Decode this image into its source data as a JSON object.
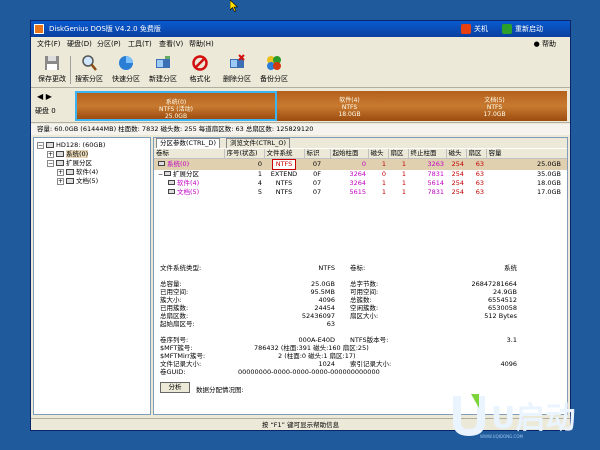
{
  "titlebar": {
    "title": "DiskGenius DOS版 V4.2.0 免费版",
    "shutdown_label": "关机",
    "restart_label": "重新启动"
  },
  "menu": [
    "文件(F)",
    "硬盘(D)",
    "分区(P)",
    "工具(T)",
    "查看(V)",
    "帮助(H)"
  ],
  "help_label": "帮助",
  "toolbar": [
    {
      "label": "保存更改",
      "icon": "save-icon"
    },
    {
      "label": "搜索分区",
      "icon": "magnifier-icon"
    },
    {
      "label": "快速分区",
      "icon": "quick-partition-icon"
    },
    {
      "label": "新建分区",
      "icon": "new-partition-icon"
    },
    {
      "label": "格式化",
      "icon": "format-icon"
    },
    {
      "label": "删除分区",
      "icon": "delete-partition-icon"
    },
    {
      "label": "备份分区",
      "icon": "backup-partition-icon"
    }
  ],
  "disk": {
    "nav_arrows": "◀ ▶",
    "label": "硬盘 0",
    "partitions": [
      {
        "name": "系统(0)",
        "fs": "NTFS (活动)",
        "size": "25.0GB"
      },
      {
        "name": "软件(4)",
        "fs": "NTFS",
        "size": "18.0GB"
      },
      {
        "name": "文档(5)",
        "fs": "NTFS",
        "size": "17.0GB"
      }
    ],
    "info": "容量: 60.0GB (61444MB)  柱面数: 7832  磁头数: 255  每道扇区数: 63  总扇区数: 125829120"
  },
  "tree": [
    {
      "label": "HD128: (60GB)",
      "expander": "−",
      "sel": false
    },
    {
      "label": "系统(0)",
      "expander": "+",
      "sel": true
    },
    {
      "label": "扩展分区",
      "expander": "−",
      "sel": false
    },
    {
      "label": "软件(4)",
      "expander": "+",
      "sel": false
    },
    {
      "label": "文档(5)",
      "expander": "+",
      "sel": false
    }
  ],
  "tabs": [
    "分区参数(CTRL_D)",
    "浏览文件(CTRL_O)"
  ],
  "table": {
    "headers": [
      "卷标",
      "序号(状态)",
      "文件系统",
      "标识",
      "起始柱面",
      "磁头",
      "扇区",
      "终止柱面",
      "磁头",
      "扇区",
      "容量"
    ],
    "rows": [
      [
        "系统(0)",
        "0",
        "NTFS",
        "07",
        "0",
        "1",
        "1",
        "3263",
        "254",
        "63",
        "25.0GB"
      ],
      [
        "扩展分区",
        "1",
        "EXTEND",
        "0F",
        "3264",
        "0",
        "1",
        "7831",
        "254",
        "63",
        "35.0GB"
      ],
      [
        "软件(4)",
        "4",
        "NTFS",
        "07",
        "3264",
        "1",
        "1",
        "5614",
        "254",
        "63",
        "18.0GB"
      ],
      [
        "文档(5)",
        "5",
        "NTFS",
        "07",
        "5615",
        "1",
        "1",
        "7831",
        "254",
        "63",
        "17.0GB"
      ]
    ]
  },
  "details": [
    {
      "k1": "文件系统类型:",
      "v1": "NTFS",
      "k2": "卷标:",
      "v2": "系统"
    },
    {
      "k1": "",
      "v1": "",
      "k2": "",
      "v2": ""
    },
    {
      "k1": "总容量:",
      "v1": "25.0GB",
      "k2": "总字节数:",
      "v2": "26847281664"
    },
    {
      "k1": "已用空间:",
      "v1": "95.5MB",
      "k2": "可用空间:",
      "v2": "24.9GB"
    },
    {
      "k1": "簇大小:",
      "v1": "4096",
      "k2": "总簇数:",
      "v2": "6554512"
    },
    {
      "k1": "已用簇数:",
      "v1": "24454",
      "k2": "空闲簇数:",
      "v2": "6530058"
    },
    {
      "k1": "总扇区数:",
      "v1": "52436097",
      "k2": "扇区大小:",
      "v2": "512 Bytes"
    },
    {
      "k1": "起始扇区号:",
      "v1": "63",
      "k2": "",
      "v2": ""
    },
    {
      "k1": "",
      "v1": "",
      "k2": "",
      "v2": ""
    },
    {
      "k1": "卷序列号:",
      "v1": "000A-E40D",
      "k2": "NTFS版本号:",
      "v2": "3.1"
    },
    {
      "k1": "$MFT簇号:",
      "v1": "786432 (柱面:391 磁头:160 扇区:25)",
      "k2": "",
      "v2": ""
    },
    {
      "k1": "$MFTMirr簇号:",
      "v1": "2 (柱面:0 磁头:1 扇区:17)",
      "k2": "",
      "v2": ""
    },
    {
      "k1": "文件记录大小:",
      "v1": "1024",
      "k2": "索引记录大小:",
      "v2": "4096"
    },
    {
      "k1": "卷GUID:",
      "v1": "00000000-0000-0000-0000-000000000000",
      "k2": "",
      "v2": ""
    }
  ],
  "analyze_label": "分析",
  "dist_label": "数据分配情况图:",
  "status": "按 “F1” 键可显示帮助信息",
  "logo": {
    "text": "U启动",
    "tag": "WWW.UQIDONG.COM"
  }
}
